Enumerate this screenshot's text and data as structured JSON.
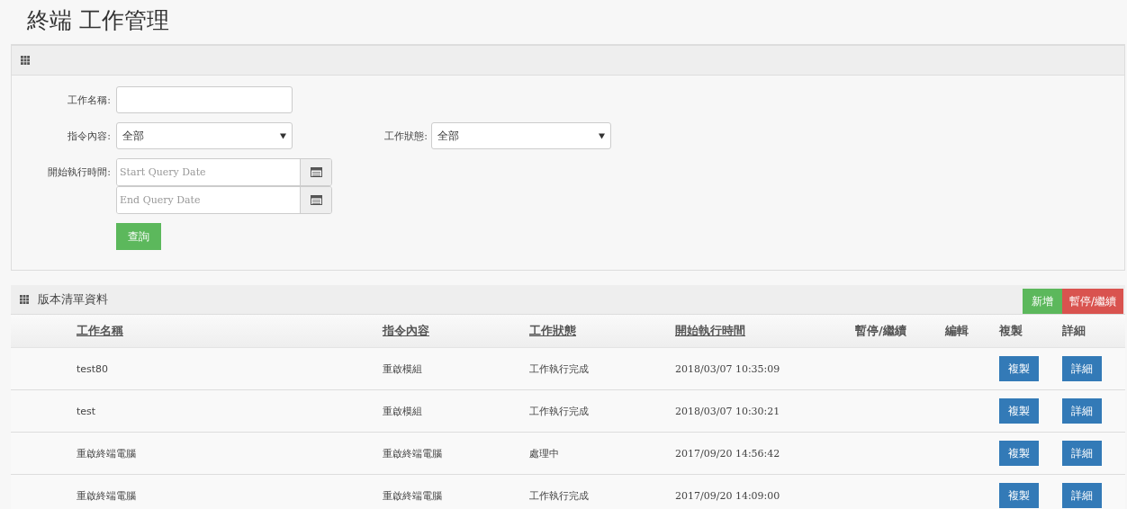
{
  "page_title": "終端 工作管理",
  "filter_panel": {
    "fields": [
      {
        "label": "工作名稱:",
        "kind": "text"
      },
      {
        "label": "指令內容:",
        "kind": "select",
        "value": "全部"
      },
      {
        "label": "工作狀態:",
        "kind": "select",
        "value": "全部"
      },
      {
        "label": "開始執行時間:",
        "kind": "daterange",
        "placeholders": [
          "Start Query Date",
          "End Query Date"
        ]
      }
    ],
    "search_button": "查詢"
  },
  "list_panel": {
    "title": "版本清單資料",
    "buttons": [
      {
        "label": "新增",
        "kind": "success"
      },
      {
        "label": "暫停/繼續",
        "kind": "danger"
      }
    ],
    "columns": [
      {
        "label": "工作名稱",
        "sortable": true
      },
      {
        "label": "指令內容",
        "sortable": true
      },
      {
        "label": "工作狀態",
        "sortable": true
      },
      {
        "label": "開始執行時間",
        "sortable": true
      },
      {
        "label": "暫停/繼續",
        "sortable": false
      },
      {
        "label": "編輯",
        "sortable": false
      },
      {
        "label": "複製",
        "sortable": false
      },
      {
        "label": "詳細",
        "sortable": false
      }
    ],
    "rows": [
      {
        "cells": [
          "test80",
          "重啟模組",
          "工作執行完成",
          "2018/03/07 10:35:09"
        ],
        "actions": [
          "複製",
          "詳細"
        ]
      },
      {
        "cells": [
          "test",
          "重啟模組",
          "工作執行完成",
          "2018/03/07 10:30:21"
        ],
        "actions": [
          "複製",
          "詳細"
        ]
      },
      {
        "cells": [
          "重啟終端電腦",
          "重啟終端電腦",
          "處理中",
          "2017/09/20 14:56:42"
        ],
        "actions": [
          "複製",
          "詳細"
        ]
      },
      {
        "cells": [
          "重啟終端電腦",
          "重啟終端電腦",
          "工作執行完成",
          "2017/09/20 14:09:00"
        ],
        "actions": [
          "複製",
          "詳細"
        ]
      }
    ]
  }
}
